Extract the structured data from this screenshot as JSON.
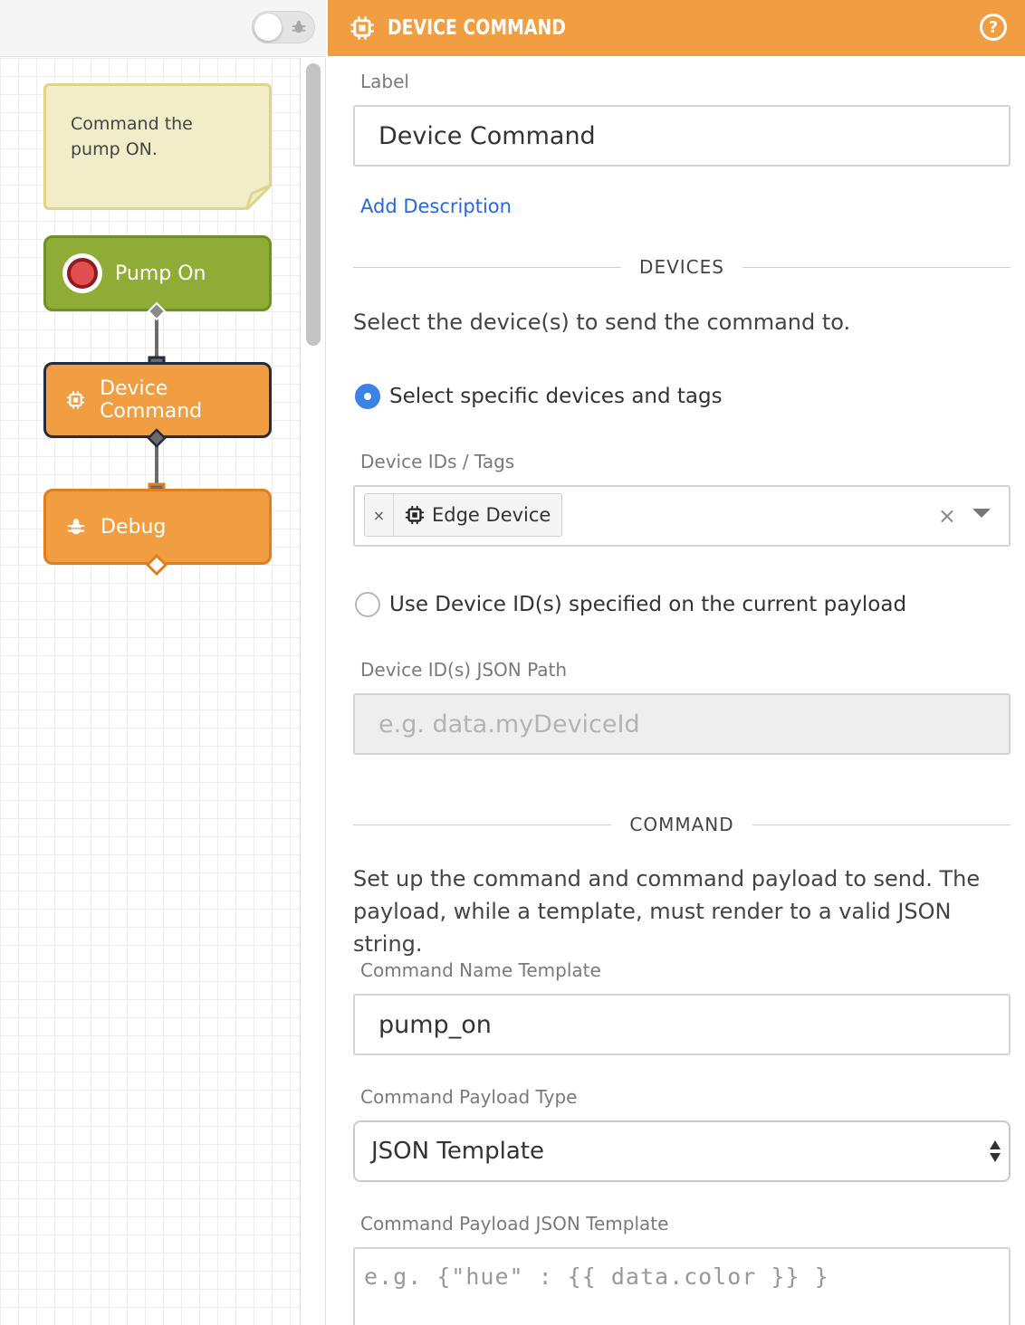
{
  "canvas": {
    "note_text": "Command the pump ON.",
    "nodes": [
      {
        "label": "Pump On"
      },
      {
        "label": "Device Command"
      },
      {
        "label": "Debug"
      }
    ]
  },
  "header": {
    "title": "DEVICE COMMAND",
    "help_glyph": "?"
  },
  "form": {
    "label_caption": "Label",
    "label_value": "Device Command",
    "add_description": "Add Description",
    "devices_section": "DEVICES",
    "devices_help": "Select the device(s) to send the command to.",
    "radio_specific": "Select specific devices and tags",
    "device_ids_caption": "Device IDs / Tags",
    "device_chip": "Edge Device",
    "chip_remove": "×",
    "clear_all": "×",
    "radio_payload": "Use Device ID(s) specified on the current payload",
    "json_path_caption": "Device ID(s) JSON Path",
    "json_path_placeholder": "e.g. data.myDeviceId",
    "command_section": "COMMAND",
    "command_help": "Set up the command and command payload to send. The payload, while a template, must render to a valid JSON string.",
    "command_name_caption": "Command Name Template",
    "command_name_value": "pump_on",
    "payload_type_caption": "Command Payload Type",
    "payload_type_value": "JSON Template",
    "payload_template_caption": "Command Payload JSON Template",
    "payload_template_placeholder": "e.g. {\"hue\" : {{ data.color }} }"
  },
  "colors": {
    "accent_orange": "#f19d42",
    "trigger_green": "#8fac36",
    "link_blue": "#2968d9",
    "radio_blue": "#3b82e8"
  },
  "icons": [
    "debug-toggle-icon",
    "device-chip-icon",
    "help-icon",
    "bug-icon",
    "stop-icon"
  ]
}
